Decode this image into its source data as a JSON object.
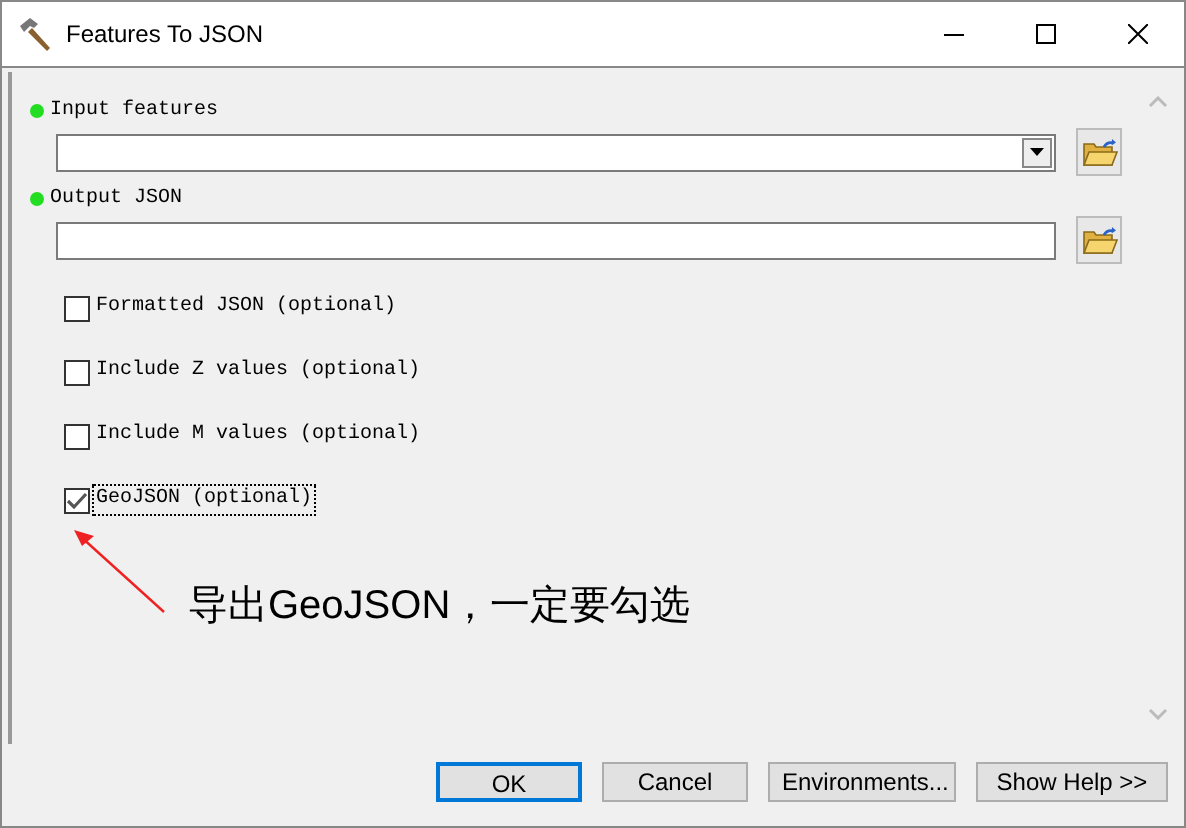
{
  "window": {
    "title": "Features To JSON"
  },
  "parameters": [
    {
      "kind": "dropdown",
      "label": "Input features",
      "required": true
    },
    {
      "kind": "text",
      "label": "Output JSON",
      "required": true
    },
    {
      "kind": "checkbox",
      "label": "Formatted JSON (optional)",
      "checked": false,
      "focused": false
    },
    {
      "kind": "checkbox",
      "label": "Include Z values (optional)",
      "checked": false,
      "focused": false
    },
    {
      "kind": "checkbox",
      "label": "Include M values (optional)",
      "checked": false,
      "focused": false
    },
    {
      "kind": "checkbox",
      "label": "GeoJSON (optional)",
      "checked": true,
      "focused": true
    }
  ],
  "annotation": {
    "text": "导出GeoJSON，一定要勾选"
  },
  "buttons": [
    {
      "label": "OK",
      "default": true
    },
    {
      "label": "Cancel",
      "default": false
    },
    {
      "label": "Environments...",
      "default": false
    },
    {
      "label": "Show Help >>",
      "default": false
    }
  ]
}
